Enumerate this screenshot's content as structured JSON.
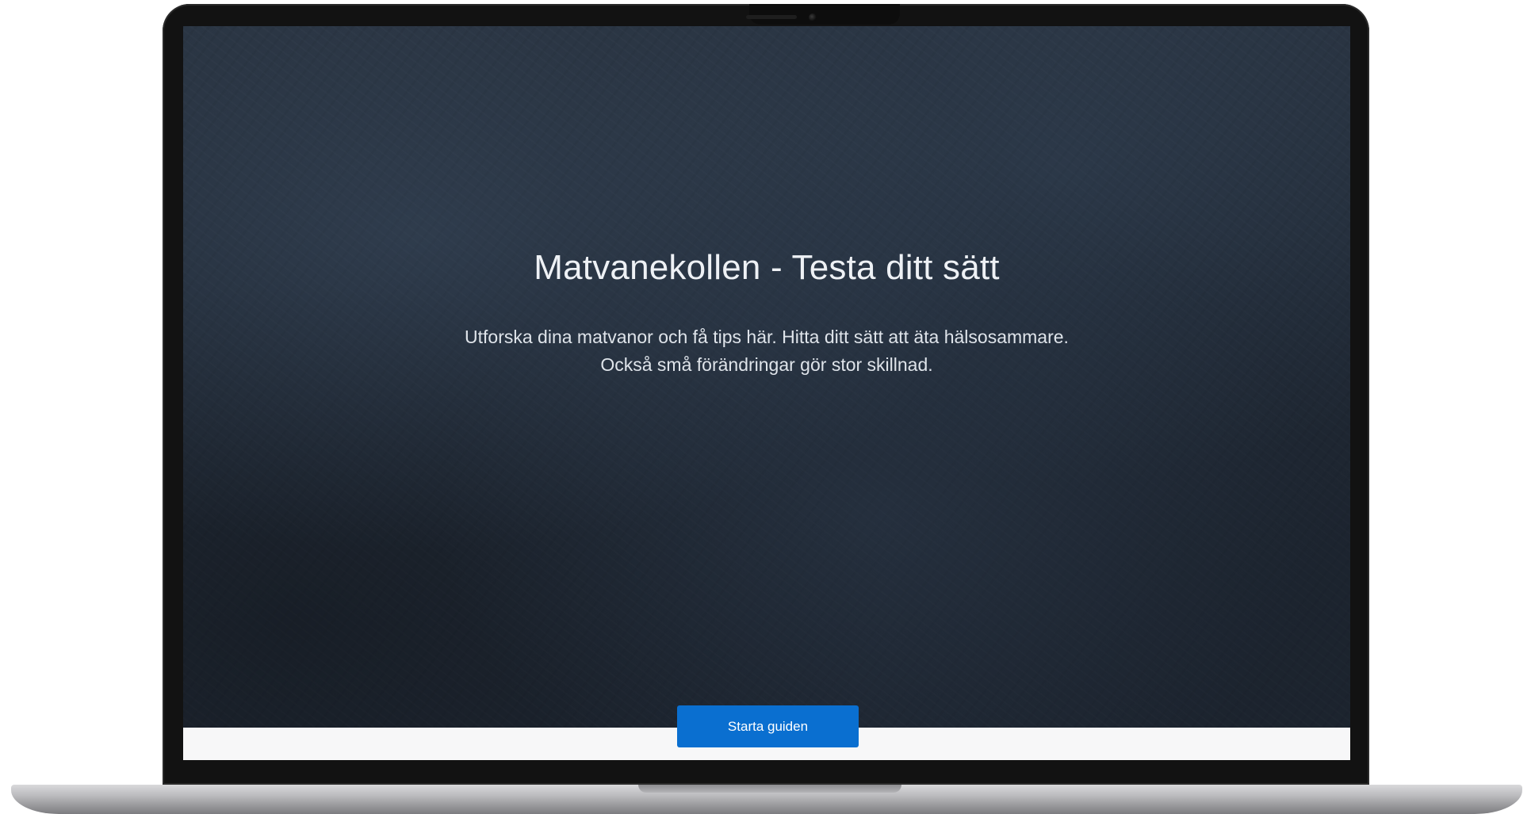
{
  "page": {
    "title": "Matvanekollen - Testa ditt sätt",
    "intro_line_1": "Utforska dina matvanor och få tips här. Hitta ditt sätt att äta hälsosammare.",
    "intro_line_2": "Också små förändringar gör stor skillnad.",
    "cta_label": "Starta guiden"
  },
  "colors": {
    "accent": "#0a6fd0",
    "hero_background": "#212a36",
    "text": "#eef1f5"
  }
}
